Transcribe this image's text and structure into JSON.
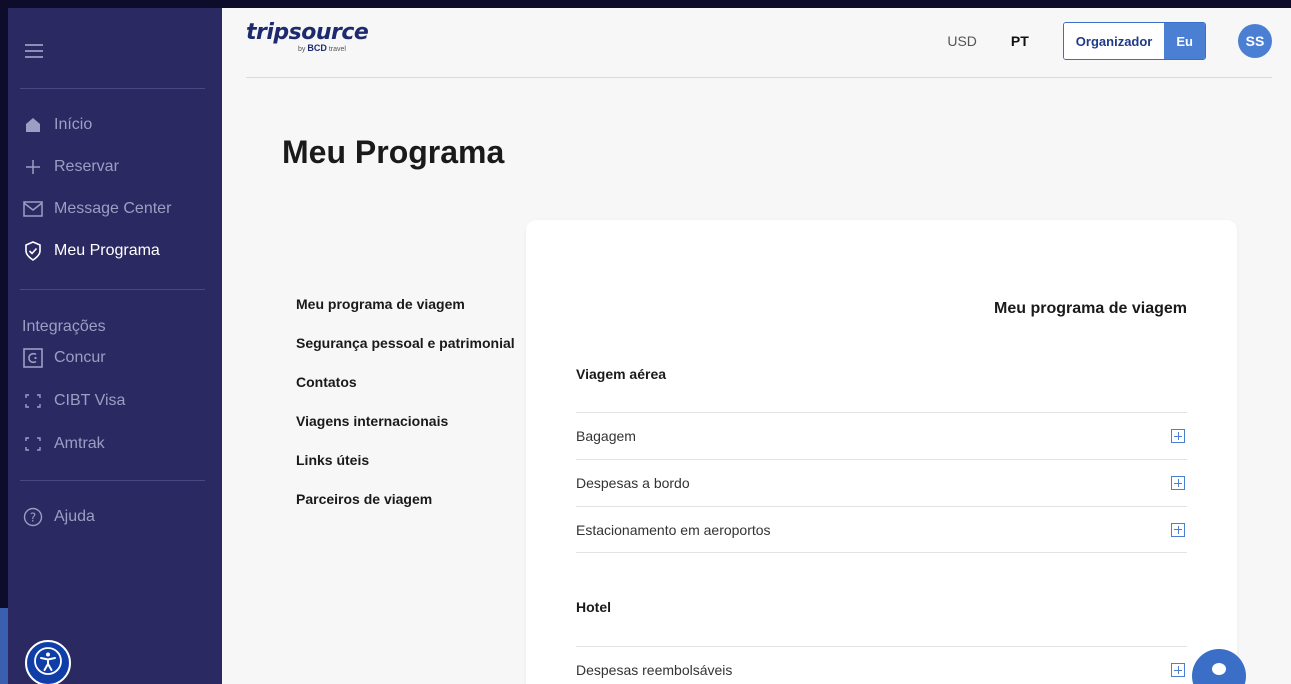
{
  "sidebar": {
    "nav": [
      {
        "label": "Início",
        "icon": "home-icon"
      },
      {
        "label": "Reservar",
        "icon": "plus-icon"
      },
      {
        "label": "Message Center",
        "icon": "mail-icon"
      },
      {
        "label": "Meu Programa",
        "icon": "shield-check-icon",
        "active": true
      }
    ],
    "integrations_title": "Integrações",
    "integrations": [
      {
        "label": "Concur",
        "icon": "concur-icon"
      },
      {
        "label": "CIBT Visa",
        "icon": "bracket-icon"
      },
      {
        "label": "Amtrak",
        "icon": "bracket-icon"
      }
    ],
    "help_label": "Ajuda"
  },
  "header": {
    "logo_text": "tripsource",
    "logo_sub_by": "by",
    "logo_sub_brand": "BCD",
    "logo_sub_travel": "travel",
    "currency": "USD",
    "language": "PT",
    "toggle_option1": "Organizador",
    "toggle_option2": "Eu",
    "avatar_initials": "SS"
  },
  "page": {
    "title": "Meu Programa",
    "side_links": [
      "Meu programa de viagem",
      "Segurança pessoal e patrimonial",
      "Contatos",
      "Viagens internacionais",
      "Links úteis",
      "Parceiros de viagem"
    ],
    "card": {
      "title": "Meu programa de viagem",
      "groups": [
        {
          "title": "Viagem aérea",
          "rows": [
            "Bagagem",
            "Despesas a bordo",
            "Estacionamento em aeroportos"
          ]
        },
        {
          "title": "Hotel",
          "rows": [
            "Despesas reembolsáveis"
          ]
        }
      ]
    }
  },
  "colors": {
    "sidebar": "#2b2961",
    "accent": "#4a7fd4",
    "brand_dark": "#1e2a6e"
  }
}
